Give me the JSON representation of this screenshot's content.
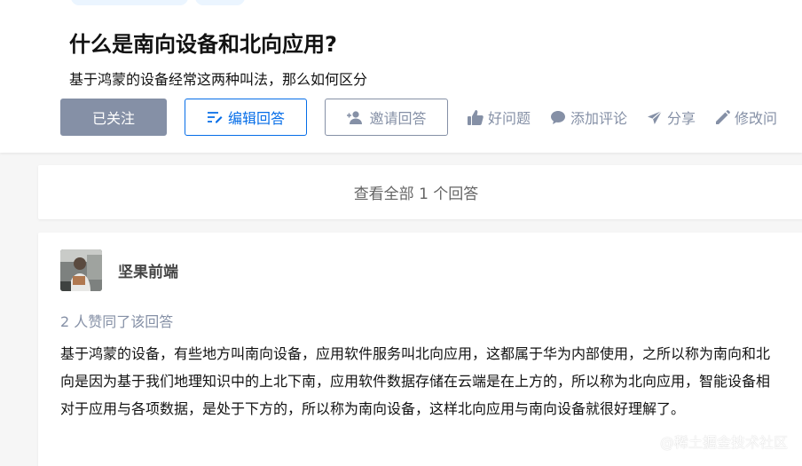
{
  "question": {
    "title": "什么是南向设备和北向应用?",
    "description": "基于鸿蒙的设备经常这两种叫法，那么如何区分"
  },
  "actions": {
    "followed_label": "已关注",
    "edit_answer_label": "编辑回答",
    "invite_label": "邀请回答",
    "good_question_label": "好问题",
    "add_comment_label": "添加评论",
    "share_label": "分享",
    "modify_label": "修改问"
  },
  "view_all": {
    "label": "查看全部 1 个回答"
  },
  "answer": {
    "author_name": "坚果前端",
    "voters_text": "2 人赞同了该回答",
    "content": "基于鸿蒙的设备，有些地方叫南向设备，应用软件服务叫北向应用，这都属于华为内部使用，之所以称为南向和北向是因为基于我们地理知识中的上北下南，应用软件数据存储在云端是在上方的，所以称为北向应用，智能设备相对于应用与各项数据，是处于下方的，所以称为南向设备，这样北向应用与南向设备就很好理解了。"
  },
  "watermark": "@稀土掘金技术社区",
  "colors": {
    "primary_blue": "#056de8",
    "gray_text": "#8590a6",
    "followed_bg": "#8590a6",
    "page_bg": "#f6f6f6"
  },
  "icons": [
    "edit-icon",
    "invite-icon",
    "thumb-up-icon",
    "comment-icon",
    "share-icon",
    "pencil-icon"
  ]
}
